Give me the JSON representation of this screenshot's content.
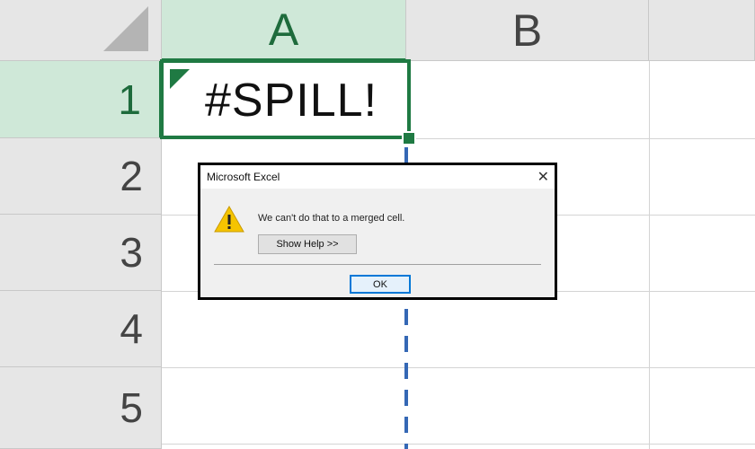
{
  "columns": [
    "A",
    "B"
  ],
  "rows": [
    "1",
    "2",
    "3",
    "4",
    "5"
  ],
  "cell_a1": {
    "value": "#SPILL!"
  },
  "dialog": {
    "title": "Microsoft Excel",
    "close_glyph": "✕",
    "message": "We can't do that to a merged cell.",
    "help_button": "Show Help >>",
    "ok_button": "OK"
  },
  "colors": {
    "selection_green": "#1f7a43",
    "header_selected": "#cfe8d8",
    "spill_border": "#3568b5",
    "warning_yellow": "#f5c400"
  },
  "icons": [
    "warning-icon",
    "close-icon",
    "error-indicator-icon",
    "select-all-icon"
  ]
}
